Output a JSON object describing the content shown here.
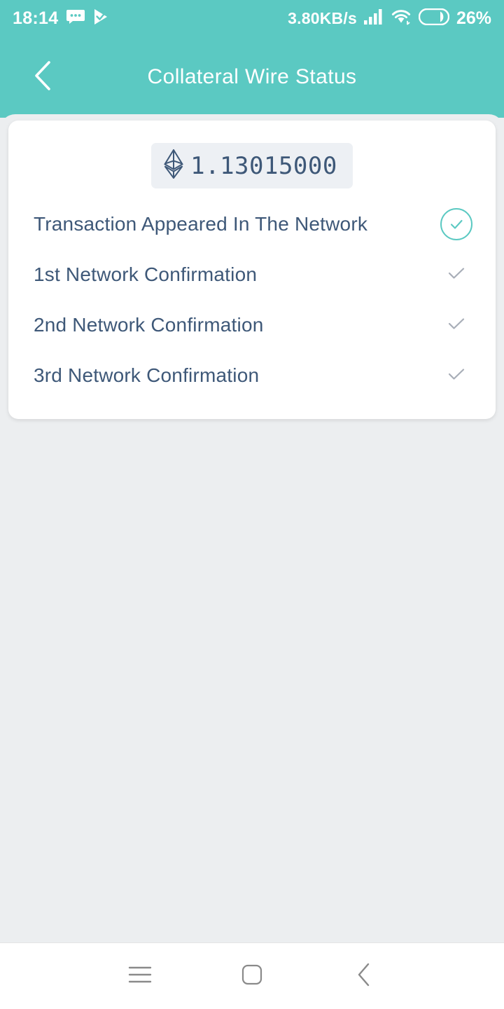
{
  "status_bar": {
    "clock": "18:14",
    "network_speed": "3.80KB/s",
    "battery_percent": "26%",
    "icons": {
      "sms": "sms-icon",
      "tick": "tick-app-icon",
      "signal": "signal-icon",
      "wifi": "wifi-icon",
      "battery": "battery-icon"
    }
  },
  "appbar": {
    "title": "Collateral Wire Status",
    "back_icon": "back-chevron-icon"
  },
  "card": {
    "amount": {
      "currency_icon": "ethereum-icon",
      "value": "1.13015000"
    },
    "rows": [
      {
        "label": "Transaction Appeared In The Network",
        "state": "completed",
        "icon": "check-circle-icon"
      },
      {
        "label": "1st Network Confirmation",
        "state": "pending",
        "icon": "check-icon"
      },
      {
        "label": "2nd Network Confirmation",
        "state": "pending",
        "icon": "check-icon"
      },
      {
        "label": "3rd Network Confirmation",
        "state": "pending",
        "icon": "check-icon"
      }
    ]
  },
  "system_nav": {
    "recents_label": "recents-icon",
    "home_label": "home-icon",
    "back_label": "back-icon"
  },
  "colors": {
    "accent_teal": "#5bc9c2",
    "text_slate": "#3e5878",
    "muted_check": "#a8aeb8",
    "page_bg": "#eceef0",
    "badge_bg": "#edf0f4"
  }
}
